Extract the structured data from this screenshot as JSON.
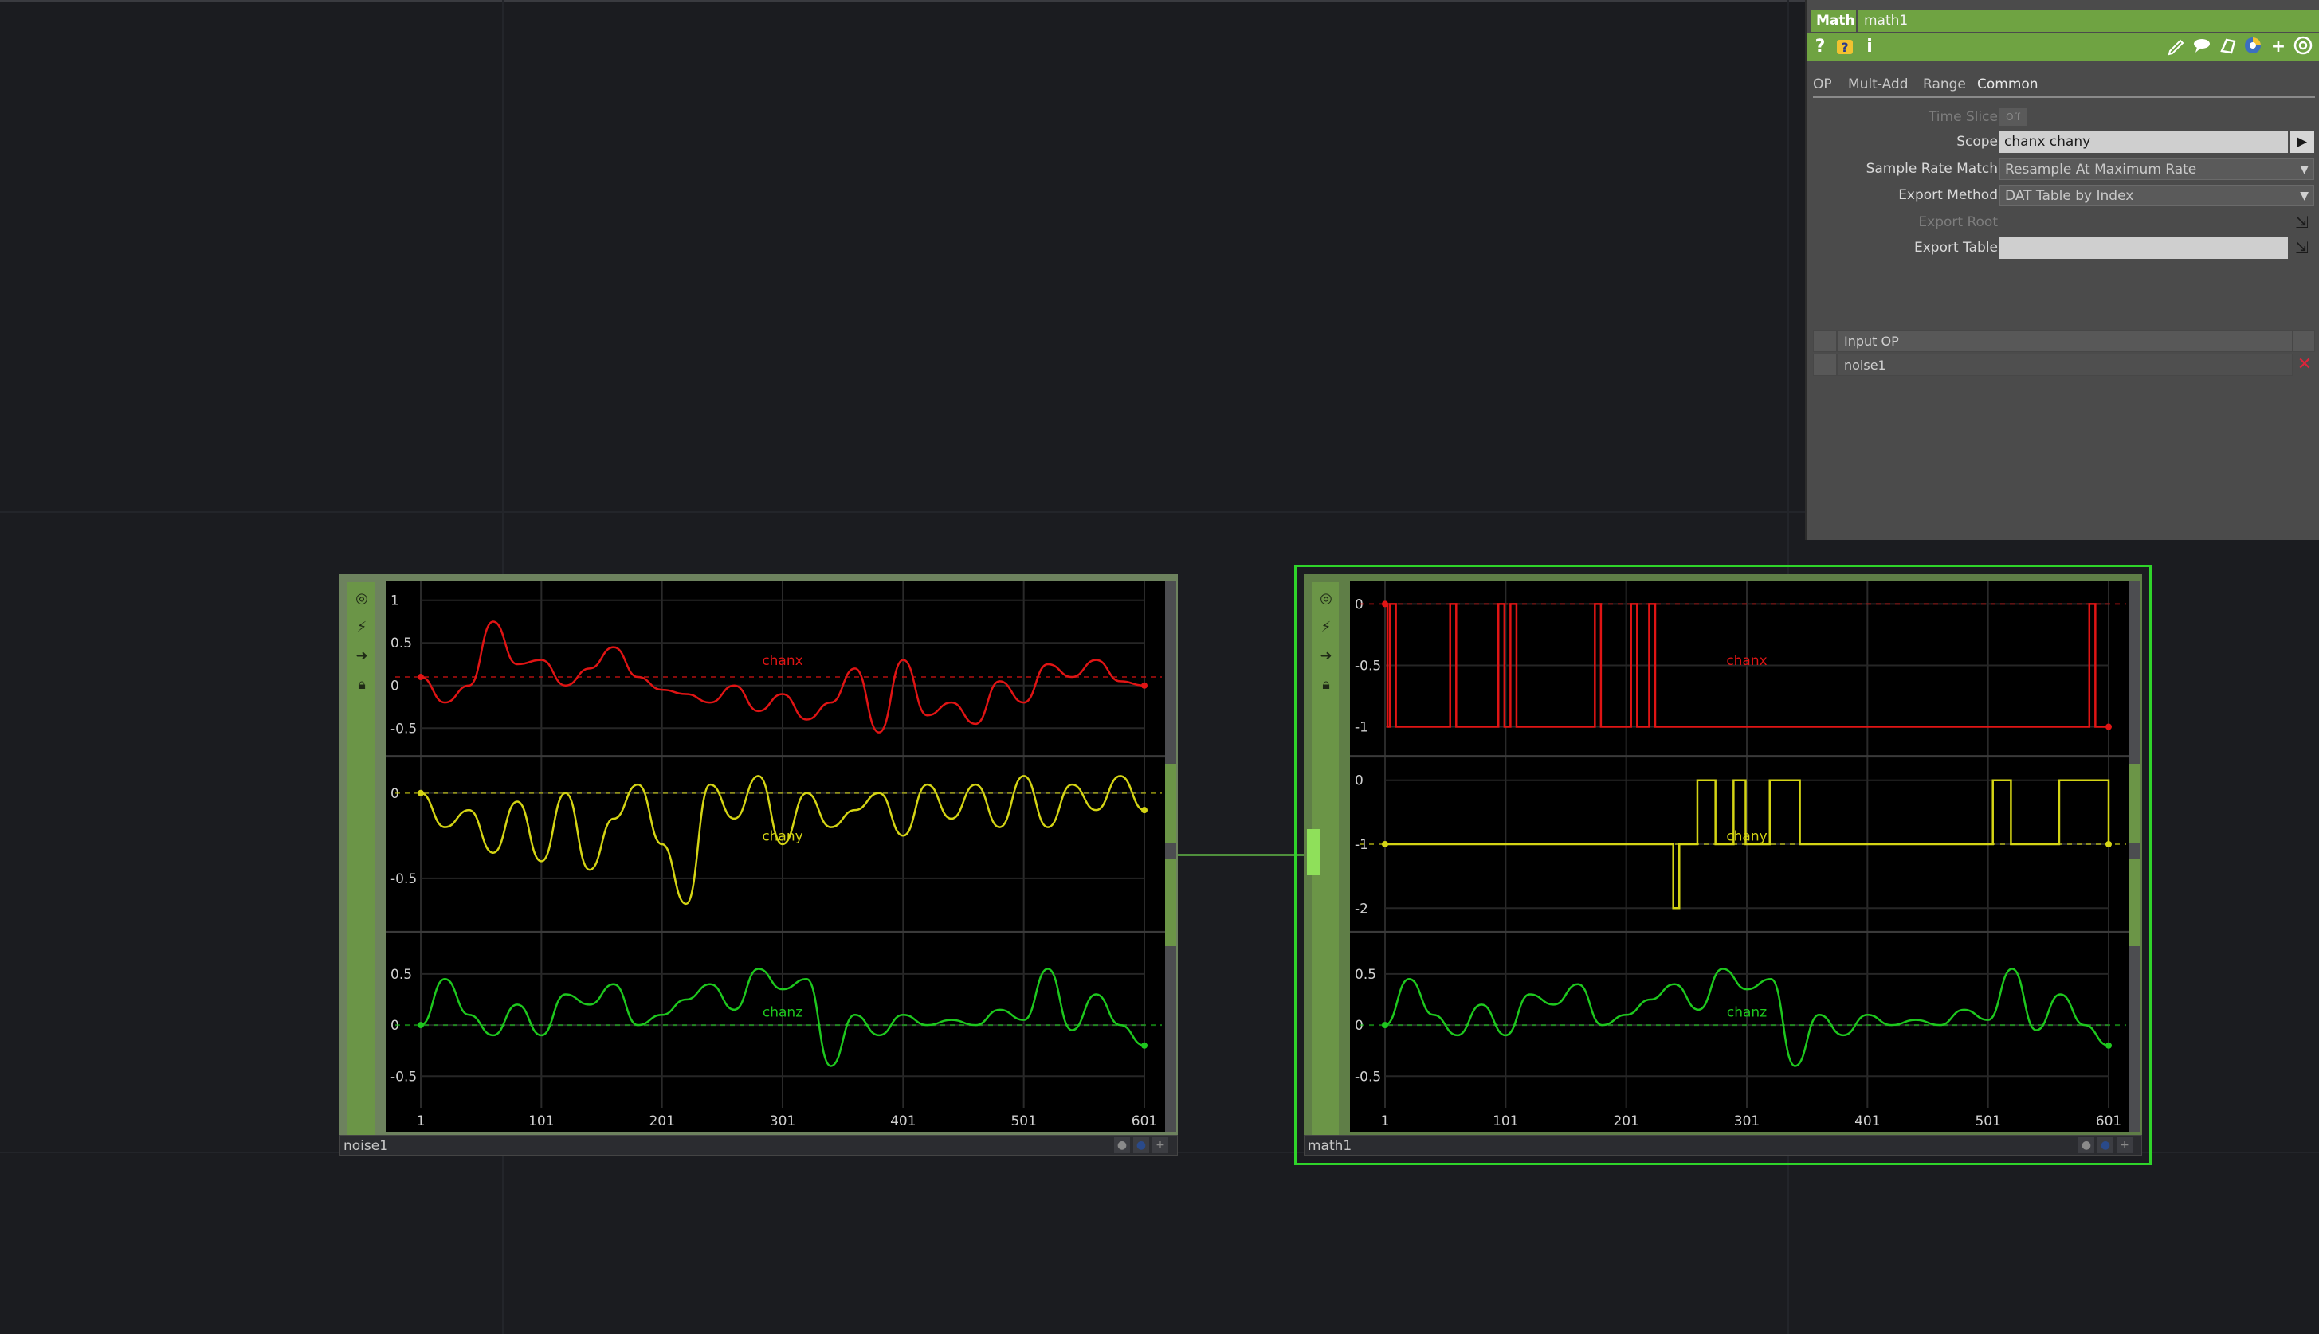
{
  "param_panel": {
    "op_type": "Math",
    "op_name": "math1",
    "tabs": [
      {
        "label": "OP",
        "active": false
      },
      {
        "label": "Mult-Add",
        "active": false
      },
      {
        "label": "Range",
        "active": false
      },
      {
        "label": "Common",
        "active": true
      }
    ],
    "params": {
      "time_slice_label": "Time Slice",
      "time_slice_value": "Off",
      "scope_label": "Scope",
      "scope_value": "chanx  chany",
      "sample_rate_match_label": "Sample Rate Match",
      "sample_rate_match_value": "Resample At Maximum Rate",
      "export_method_label": "Export Method",
      "export_method_value": "DAT Table by Index",
      "export_root_label": "Export Root",
      "export_table_label": "Export Table",
      "export_table_value": ""
    },
    "input_table": {
      "header": "Input OP",
      "rows": [
        "noise1"
      ]
    },
    "icons": {
      "help": "?",
      "python_help": "python-help-icon",
      "info": "i",
      "edit": "pencil-icon",
      "comment": "comment-icon",
      "clone": "clone-icon",
      "python": "python-icon",
      "add": "+",
      "target": "target-icon"
    }
  },
  "nodes": [
    {
      "name": "noise1",
      "selected": false
    },
    {
      "name": "math1",
      "selected": true
    }
  ],
  "chart_data": [
    {
      "type": "line",
      "title": "noise1",
      "x_ticks": [
        1,
        101,
        201,
        301,
        401,
        501,
        601
      ],
      "xlim": [
        1,
        601
      ],
      "panels": [
        {
          "name": "chanx",
          "color": "#e01414",
          "y_ticks": [
            "1",
            "0.5",
            "0",
            "-0.5"
          ],
          "ylim": [
            -0.7,
            1.1
          ],
          "x": [
            1,
            21,
            41,
            61,
            81,
            101,
            121,
            141,
            161,
            181,
            201,
            221,
            241,
            261,
            281,
            301,
            321,
            341,
            361,
            381,
            401,
            421,
            441,
            461,
            481,
            501,
            521,
            541,
            561,
            581,
            601
          ],
          "values": [
            0.1,
            -0.2,
            0.0,
            0.75,
            0.25,
            0.3,
            0.0,
            0.2,
            0.45,
            0.1,
            -0.05,
            -0.1,
            -0.2,
            0.0,
            -0.3,
            -0.1,
            -0.4,
            -0.2,
            0.2,
            -0.55,
            0.3,
            -0.35,
            -0.2,
            -0.45,
            0.05,
            -0.2,
            0.25,
            0.1,
            0.3,
            0.05,
            0.0
          ]
        },
        {
          "name": "chany",
          "color": "#d4d414",
          "y_ticks": [
            "0",
            "-0.5"
          ],
          "ylim": [
            -0.75,
            0.15
          ],
          "x": [
            1,
            21,
            41,
            61,
            81,
            101,
            121,
            141,
            161,
            181,
            201,
            221,
            241,
            261,
            281,
            301,
            321,
            341,
            361,
            381,
            401,
            421,
            441,
            461,
            481,
            501,
            521,
            541,
            561,
            581,
            601
          ],
          "values": [
            0.0,
            -0.2,
            -0.1,
            -0.35,
            -0.05,
            -0.4,
            0.0,
            -0.45,
            -0.15,
            0.05,
            -0.3,
            -0.65,
            0.05,
            -0.15,
            0.1,
            -0.3,
            0.0,
            -0.2,
            -0.1,
            0.0,
            -0.25,
            0.05,
            -0.15,
            0.05,
            -0.2,
            0.1,
            -0.2,
            0.05,
            -0.1,
            0.1,
            -0.1
          ]
        },
        {
          "name": "chanz",
          "color": "#1ec81e",
          "y_ticks": [
            "0.5",
            "0",
            "-0.5"
          ],
          "ylim": [
            -0.7,
            0.8
          ],
          "x": [
            1,
            21,
            41,
            61,
            81,
            101,
            121,
            141,
            161,
            181,
            201,
            221,
            241,
            261,
            281,
            301,
            321,
            341,
            361,
            381,
            401,
            421,
            441,
            461,
            481,
            501,
            521,
            541,
            561,
            581,
            601
          ],
          "values": [
            0.0,
            0.45,
            0.1,
            -0.1,
            0.2,
            -0.1,
            0.3,
            0.2,
            0.4,
            0.0,
            0.1,
            0.25,
            0.4,
            0.15,
            0.55,
            0.35,
            0.45,
            -0.4,
            0.1,
            -0.1,
            0.1,
            0.0,
            0.05,
            0.0,
            0.15,
            0.05,
            0.55,
            -0.05,
            0.3,
            0.0,
            -0.2
          ]
        }
      ]
    },
    {
      "type": "line",
      "title": "math1",
      "x_ticks": [
        1,
        101,
        201,
        301,
        401,
        501,
        601
      ],
      "xlim": [
        1,
        601
      ],
      "panels": [
        {
          "name": "chanx",
          "color": "#e01414",
          "y_ticks": [
            "0",
            "-0.5",
            "-1"
          ],
          "ylim": [
            -1.15,
            0.1
          ],
          "step": true,
          "x": [
            1,
            3,
            5,
            10,
            12,
            55,
            60,
            95,
            100,
            105,
            110,
            175,
            180,
            205,
            210,
            215,
            220,
            225,
            585,
            590,
            601
          ],
          "values": [
            0,
            -1,
            0,
            -1,
            -1,
            0,
            -1,
            0,
            -1,
            0,
            -1,
            0,
            -1,
            0,
            -1,
            -1,
            0,
            -1,
            0,
            -1,
            -1
          ]
        },
        {
          "name": "chany",
          "color": "#d4d414",
          "y_ticks": [
            "0",
            "-1",
            "-2"
          ],
          "ylim": [
            -2.2,
            0.2
          ],
          "step": true,
          "x": [
            1,
            240,
            245,
            260,
            275,
            290,
            300,
            320,
            345,
            505,
            520,
            560,
            601
          ],
          "values": [
            -1,
            -2,
            -1,
            0,
            -1,
            0,
            -1,
            0,
            -1,
            0,
            -1,
            0,
            -1
          ]
        },
        {
          "name": "chanz",
          "color": "#1ec81e",
          "y_ticks": [
            "0.5",
            "0",
            "-0.5"
          ],
          "ylim": [
            -0.7,
            0.8
          ],
          "x": [
            1,
            21,
            41,
            61,
            81,
            101,
            121,
            141,
            161,
            181,
            201,
            221,
            241,
            261,
            281,
            301,
            321,
            341,
            361,
            381,
            401,
            421,
            441,
            461,
            481,
            501,
            521,
            541,
            561,
            581,
            601
          ],
          "values": [
            0.0,
            0.45,
            0.1,
            -0.1,
            0.2,
            -0.1,
            0.3,
            0.2,
            0.4,
            0.0,
            0.1,
            0.25,
            0.4,
            0.15,
            0.55,
            0.35,
            0.45,
            -0.4,
            0.1,
            -0.1,
            0.1,
            0.0,
            0.05,
            0.0,
            0.15,
            0.05,
            0.55,
            -0.05,
            0.3,
            0.0,
            -0.2
          ]
        }
      ]
    }
  ]
}
